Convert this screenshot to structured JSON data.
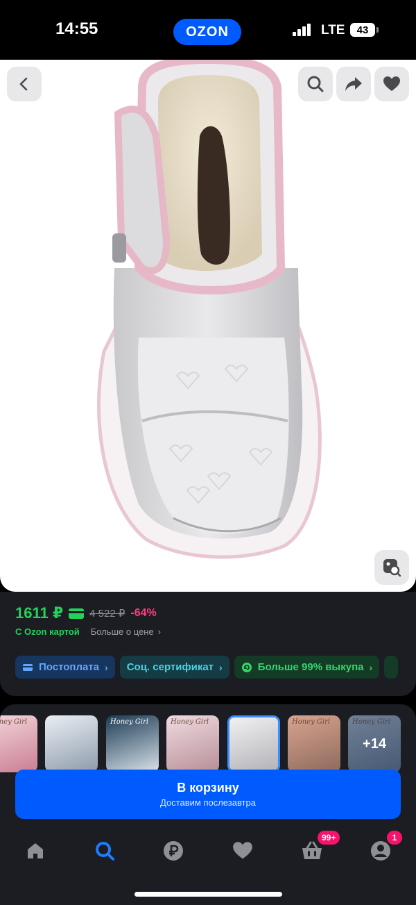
{
  "status": {
    "time": "14:55",
    "carrier_logo": "OZON",
    "network": "LTE",
    "battery": "43"
  },
  "gallery": {
    "back_icon": "chevron-left-icon",
    "search_icon": "search-icon",
    "share_icon": "share-icon",
    "favorite_icon": "heart-icon",
    "visual_search_icon": "image-search-icon"
  },
  "price": {
    "current": "1611 ₽",
    "old": "4 522 ₽",
    "discount": "-64%",
    "card_label": "С Ozon картой",
    "more_label": "Больше о цене",
    "accent_green": "#24d15a",
    "discount_color": "#ff3b7f"
  },
  "chips": [
    {
      "label": "Постоплата",
      "icon": "postpay-icon",
      "color": "#62a7ff"
    },
    {
      "label": "Соц. сертификат",
      "icon": "",
      "color": "#48d4e5"
    },
    {
      "label": "Больше 99% выкупа",
      "icon": "refresh-icon",
      "color": "#33d66d"
    }
  ],
  "variants": {
    "brand_text": "Honey Girl",
    "more_count": "+14",
    "selected_index": 4
  },
  "cart": {
    "title": "В корзину",
    "subtitle": "Доставим послезавтра",
    "color": "#005bff"
  },
  "tabbar": {
    "items": [
      {
        "name": "home",
        "icon": "home-icon"
      },
      {
        "name": "search",
        "icon": "search-icon",
        "active": true
      },
      {
        "name": "finance",
        "icon": "ruble-icon"
      },
      {
        "name": "favorites",
        "icon": "heart-icon"
      },
      {
        "name": "cart",
        "icon": "basket-icon",
        "badge": "99+"
      },
      {
        "name": "profile",
        "icon": "profile-icon",
        "badge": "1"
      }
    ]
  }
}
